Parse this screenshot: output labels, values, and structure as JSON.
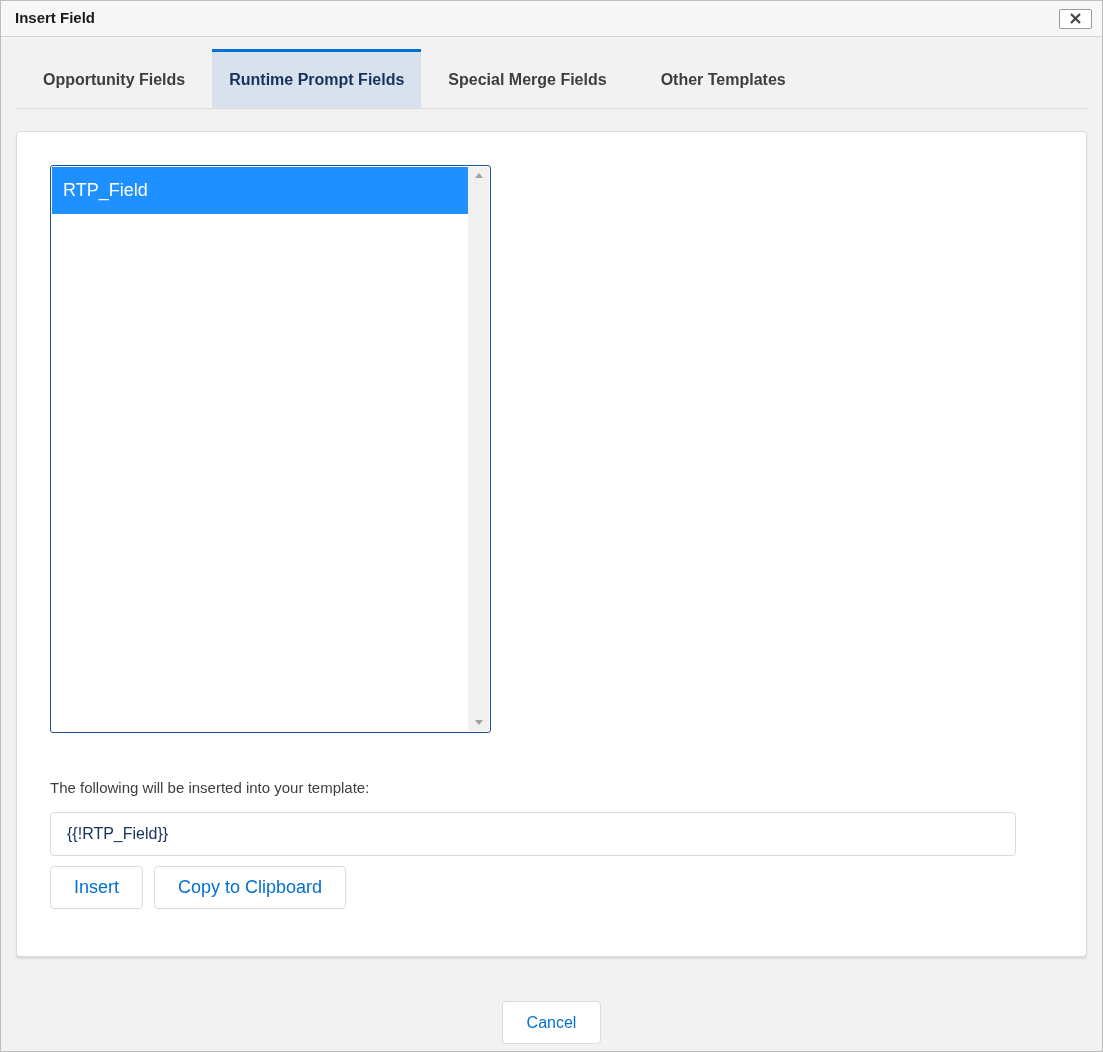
{
  "window": {
    "title": "Insert Field"
  },
  "tabs": [
    {
      "label": "Opportunity Fields",
      "selected": false
    },
    {
      "label": "Runtime Prompt Fields",
      "selected": true
    },
    {
      "label": "Special Merge Fields",
      "selected": false
    },
    {
      "label": "Other Templates",
      "selected": false
    }
  ],
  "field_list": [
    {
      "label": "RTP_Field",
      "selected": true
    }
  ],
  "preview": {
    "label": "The following will be inserted into your template:",
    "value": "{{!RTP_Field}}"
  },
  "buttons": [
    "Insert",
    "Copy to Clipboard"
  ],
  "footer": {
    "cancel": "Cancel"
  }
}
